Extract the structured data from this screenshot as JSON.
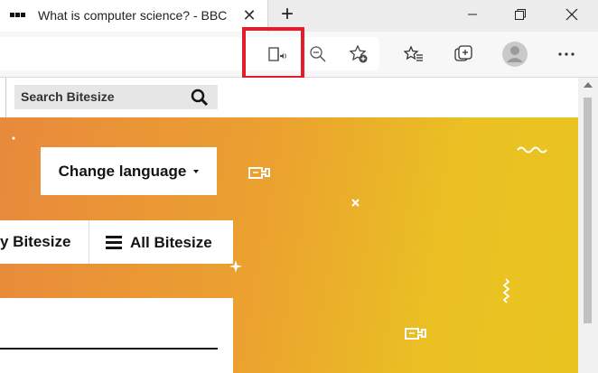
{
  "browser": {
    "tab_title": "What is computer science? - BBC Bitesize",
    "tab_close": "✕",
    "new_tab": "+",
    "window": {
      "minimize": "minimize",
      "maximize": "restore",
      "close": "close"
    },
    "toolbar_icons": [
      "immersive-reader-icon",
      "zoom-out-icon",
      "add-favorite-icon",
      "favorites-icon",
      "collections-icon",
      "profile-icon",
      "more-icon"
    ],
    "highlight_color": "#e41d2a"
  },
  "page": {
    "search": {
      "placeholder": "Search Bitesize"
    },
    "change_language": "Change language",
    "nav": {
      "my_bitesize": "y Bitesize",
      "all_bitesize": "All Bitesize"
    },
    "colors": {
      "hero_start": "#e8893c",
      "hero_end": "#e9c420"
    }
  }
}
